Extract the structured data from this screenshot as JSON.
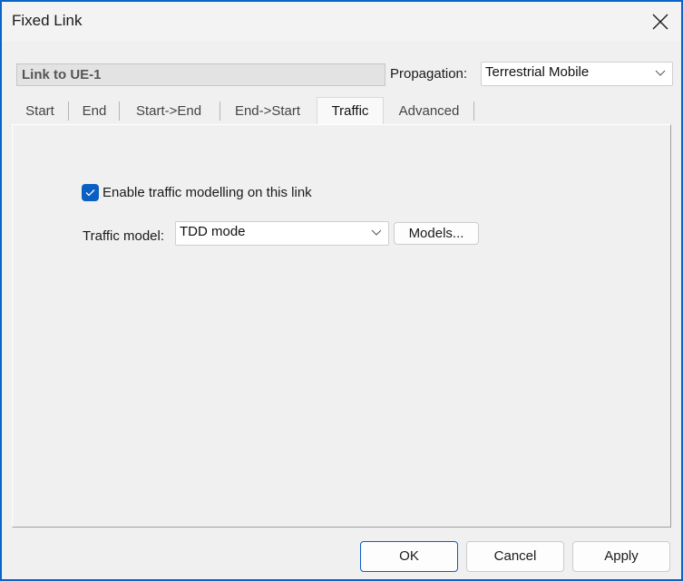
{
  "window": {
    "title": "Fixed Link",
    "close_icon": "close-icon"
  },
  "header": {
    "link_name": "Link to UE-1",
    "propagation_label": "Propagation:",
    "propagation_value": "Terrestrial Mobile"
  },
  "tabs": [
    {
      "label": "Start",
      "active": false
    },
    {
      "label": "End",
      "active": false
    },
    {
      "label": "Start->End",
      "active": false
    },
    {
      "label": "End->Start",
      "active": false
    },
    {
      "label": "Traffic",
      "active": true
    },
    {
      "label": "Advanced",
      "active": false
    }
  ],
  "traffic": {
    "enable_checkbox_label": "Enable traffic modelling on this link",
    "enable_checked": true,
    "model_label": "Traffic model:",
    "model_value": "TDD mode",
    "models_button": "Models..."
  },
  "footer": {
    "ok": "OK",
    "cancel": "Cancel",
    "apply": "Apply"
  },
  "colors": {
    "accent": "#0a5fc2",
    "window_border": "#0a64c8"
  }
}
